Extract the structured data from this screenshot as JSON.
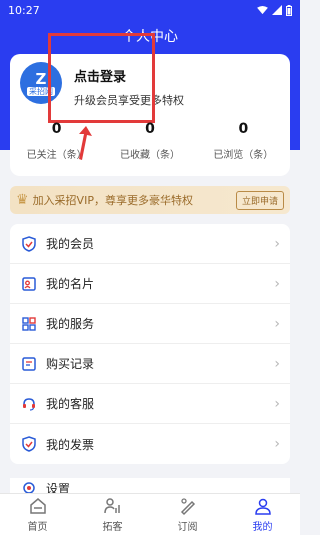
{
  "status": {
    "time": "10:27"
  },
  "header": {
    "title": "个人中心"
  },
  "profile": {
    "logo_text": "采招网",
    "login_title": "点击登录",
    "login_sub": "升级会员享受更多特权"
  },
  "stats": [
    {
      "value": "0",
      "label": "已关注（条）"
    },
    {
      "value": "0",
      "label": "已收藏（条）"
    },
    {
      "value": "0",
      "label": "已浏览（条）"
    }
  ],
  "vip": {
    "text": "加入采招VIP，尊享更多豪华特权",
    "button": "立即申请",
    "accent": "#c99a4c"
  },
  "menu": [
    {
      "label": "我的会员",
      "icon": "member-icon"
    },
    {
      "label": "我的名片",
      "icon": "card-icon"
    },
    {
      "label": "我的服务",
      "icon": "service-icon"
    },
    {
      "label": "购买记录",
      "icon": "purchase-record-icon"
    },
    {
      "label": "我的客服",
      "icon": "customer-service-icon"
    },
    {
      "label": "我的发票",
      "icon": "invoice-icon"
    }
  ],
  "settings_label": "设置",
  "tabs": [
    {
      "label": "首页",
      "icon": "home-icon"
    },
    {
      "label": "拓客",
      "icon": "prospect-icon"
    },
    {
      "label": "订阅",
      "icon": "subscribe-icon"
    },
    {
      "label": "我的",
      "icon": "profile-icon"
    }
  ],
  "colors": {
    "brand": "#2a3df0",
    "highlight": "#e23a3a"
  }
}
